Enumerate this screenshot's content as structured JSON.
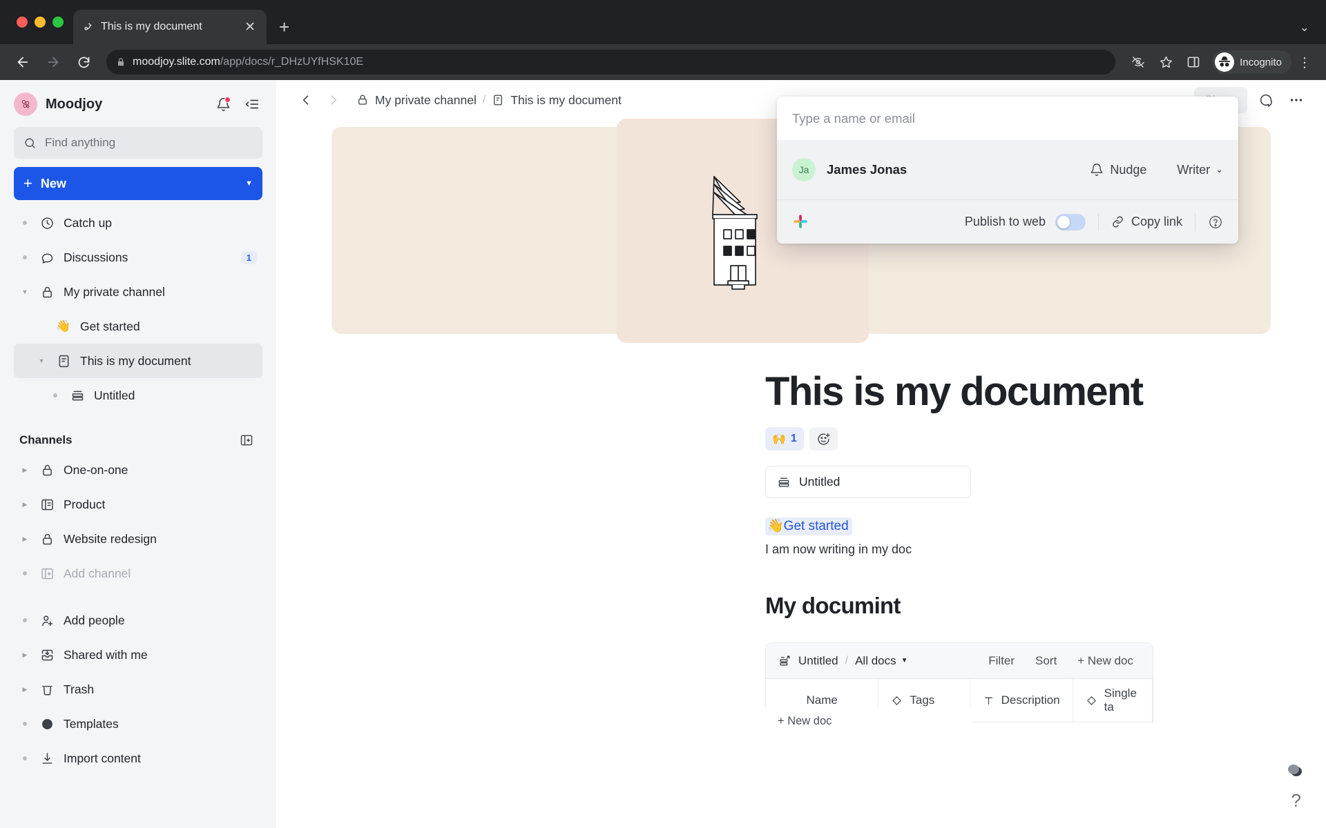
{
  "browser": {
    "tab": {
      "title": "This is my document",
      "favicon_icon": "slite-favicon",
      "close_icon": "close-icon"
    },
    "newtab_label": "+",
    "tabstrip_chevron_icon": "chevron-down-icon",
    "nav": {
      "back_icon": "arrow-left-icon",
      "forward_icon": "arrow-right-icon",
      "reload_icon": "reload-icon"
    },
    "omnibox": {
      "lock_icon": "lock-icon",
      "url_domain": "moodjoy.slite.com",
      "url_path": "/app/docs/r_DHzUYfHSK10E",
      "full_url": "moodjoy.slite.com/app/docs/r_DHzUYfHSK10E"
    },
    "toolbar_right": {
      "tracking_icon": "eye-slash-icon",
      "bookmark_icon": "star-icon",
      "sidepanel_icon": "side-panel-icon",
      "profile_icon": "incognito-icon",
      "profile_label": "Incognito",
      "menu_icon": "kebab-menu-icon"
    }
  },
  "sidebar": {
    "workspace": {
      "name": "Moodjoy",
      "logo_icon": "moodjoy-logo",
      "notifications_icon": "bell-icon",
      "collapse_icon": "collapse-sidebar-icon"
    },
    "search": {
      "placeholder": "Find anything",
      "icon": "search-icon"
    },
    "new_button": {
      "label": "New",
      "plus_icon": "plus-icon",
      "caret_icon": "chevron-down-icon"
    },
    "nav": [
      {
        "label": "Catch up",
        "icon": "clock-icon",
        "badge": "",
        "twisty": "dot",
        "indent": 0
      },
      {
        "label": "Discussions",
        "icon": "chat-icon",
        "badge": "1",
        "twisty": "dot",
        "indent": 0
      },
      {
        "label": "My private channel",
        "icon": "lock-icon",
        "badge": "",
        "twisty": "down",
        "indent": 0
      },
      {
        "label": "Get started",
        "icon": "wave-emoji",
        "badge": "",
        "twisty": "none",
        "indent": 1
      },
      {
        "label": "This is my document",
        "icon": "doc-icon",
        "badge": "",
        "twisty": "down",
        "indent": 1,
        "selected": true
      },
      {
        "label": "Untitled",
        "icon": "collection-icon",
        "badge": "",
        "twisty": "dot",
        "indent": 2
      }
    ],
    "channels_section": {
      "title": "Channels",
      "add_icon": "add-channel-icon"
    },
    "channels": [
      {
        "label": "One-on-one",
        "icon": "lock-icon",
        "twisty": "right"
      },
      {
        "label": "Product",
        "icon": "channel-icon",
        "twisty": "right"
      },
      {
        "label": "Website redesign",
        "icon": "lock-icon",
        "twisty": "right"
      },
      {
        "label": "Add channel",
        "icon": "add-channel-icon",
        "twisty": "dot",
        "muted": true
      }
    ],
    "footer": [
      {
        "label": "Add people",
        "icon": "add-person-icon",
        "twisty": "dot"
      },
      {
        "label": "Shared with me",
        "icon": "inbox-down-icon",
        "twisty": "right"
      },
      {
        "label": "Trash",
        "icon": "trash-icon",
        "twisty": "right"
      },
      {
        "label": "Templates",
        "icon": "templates-icon",
        "twisty": "dot"
      },
      {
        "label": "Import content",
        "icon": "download-icon",
        "twisty": "dot"
      }
    ]
  },
  "topbar": {
    "back_icon": "chevron-left-icon",
    "forward_icon": "chevron-right-icon",
    "breadcrumb": [
      {
        "label": "My private channel",
        "icon": "lock-icon"
      },
      {
        "label": "This is my document",
        "icon": "doc-icon"
      }
    ],
    "separator": "/",
    "share_label": "Share",
    "comment_icon": "comment-icon",
    "more_icon": "more-horizontal-icon"
  },
  "hero": {
    "illustration_icon": "building-sketch-illustration",
    "bg_color": "#f3eade",
    "card_color": "#f3e4da"
  },
  "document": {
    "title": "This is my document",
    "reactions": [
      {
        "emoji": "🙌",
        "count": "1",
        "active": true
      },
      {
        "icon": "add-reaction-icon",
        "active": false
      }
    ],
    "embed_chip": {
      "label": "Untitled",
      "icon": "collection-icon"
    },
    "internal_link": {
      "emoji": "👋",
      "label": "Get started"
    },
    "paragraph": "I am now writing in my doc",
    "heading2": "My documint"
  },
  "collection": {
    "icon": "collection-open-icon",
    "name": "Untitled",
    "separator": "/",
    "view": "All docs",
    "view_caret_icon": "caret-down-icon",
    "actions": [
      "Filter",
      "Sort"
    ],
    "new_doc_label": "+ New doc",
    "columns": [
      {
        "label": "Name",
        "icon": ""
      },
      {
        "label": "Tags",
        "icon": "tag-icon"
      },
      {
        "label": "Description",
        "icon": "text-icon"
      },
      {
        "label": "Single ta",
        "icon": "tag-icon"
      }
    ],
    "row_new_doc": "+ New doc"
  },
  "share_popup": {
    "input_placeholder": "Type a name or email",
    "member": {
      "avatar_initials": "Ja",
      "name": "James Jonas",
      "nudge_label": "Nudge",
      "nudge_icon": "bell-icon",
      "role": "Writer",
      "role_caret_icon": "chevron-down-icon"
    },
    "footer": {
      "slack_icon": "slack-icon",
      "publish_label": "Publish to web",
      "publish_enabled": false,
      "copy_link_label": "Copy link",
      "link_icon": "link-icon",
      "help_icon": "help-circle-icon"
    }
  },
  "floating": {
    "bubble_icon": "feedback-bubble-icon",
    "help_label": "?"
  },
  "cursor": {
    "icon": "mouse-pointer"
  }
}
